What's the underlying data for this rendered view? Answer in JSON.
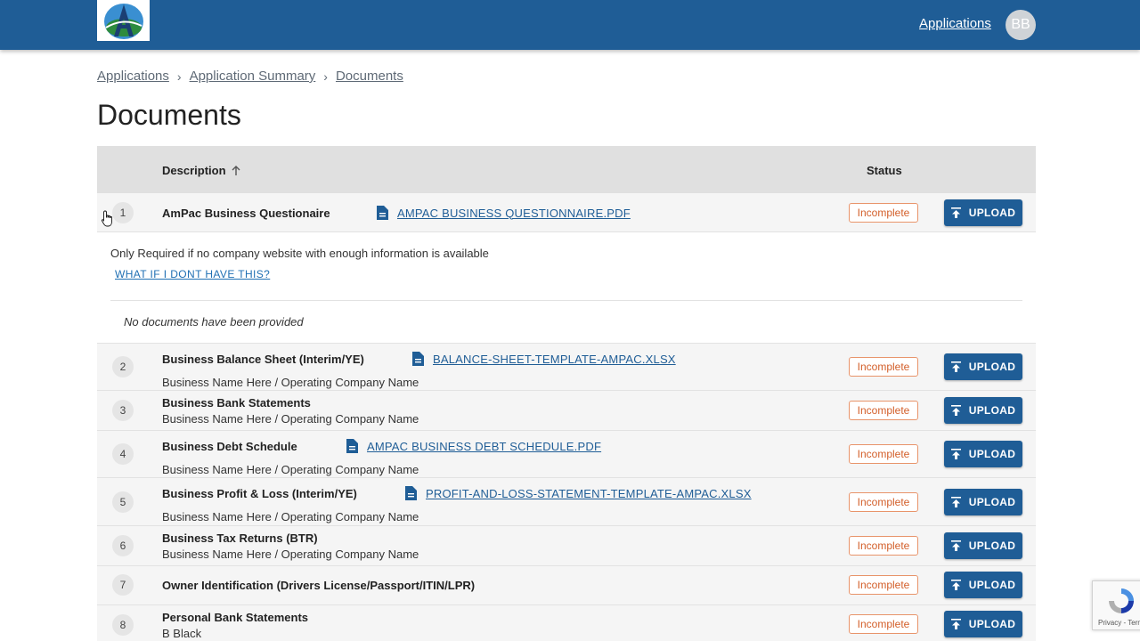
{
  "header": {
    "logo_alt": "A",
    "applications_link": "Applications",
    "avatar_initials": "BB",
    "colors": {
      "bar": "#1f5d96",
      "accent": "#1f5d96",
      "status": "#d35f2a"
    }
  },
  "breadcrumb": {
    "items": [
      "Applications",
      "Application Summary",
      "Documents"
    ],
    "separator": "›"
  },
  "page_title": "Documents",
  "table": {
    "headers": {
      "description": "Description",
      "status": "Status"
    },
    "sort_icon": "arrow-up-icon",
    "upload_label": "UPLOAD",
    "rows": [
      {
        "num": "1",
        "title": "AmPac Business Questionaire",
        "sub": "",
        "file": "AMPAC BUSINESS QUESTIONNAIRE.PDF",
        "status": "Incomplete"
      },
      {
        "num": "2",
        "title": "Business Balance Sheet (Interim/YE)",
        "sub": "Business Name Here / Operating Company Name",
        "file": "BALANCE-SHEET-TEMPLATE-AMPAC.XLSX",
        "status": "Incomplete"
      },
      {
        "num": "3",
        "title": "Business Bank Statements",
        "sub": "Business Name Here / Operating Company Name",
        "file": "",
        "status": "Incomplete"
      },
      {
        "num": "4",
        "title": "Business Debt Schedule",
        "sub": "Business Name Here / Operating Company Name",
        "file": "AMPAC BUSINESS DEBT SCHEDULE.PDF",
        "status": "Incomplete"
      },
      {
        "num": "5",
        "title": "Business Profit & Loss (Interim/YE)",
        "sub": "Business Name Here / Operating Company Name",
        "file": "PROFIT-AND-LOSS-STATEMENT-TEMPLATE-AMPAC.XLSX",
        "status": "Incomplete"
      },
      {
        "num": "6",
        "title": "Business Tax Returns (BTR)",
        "sub": "Business Name Here / Operating Company Name",
        "file": "",
        "status": "Incomplete"
      },
      {
        "num": "7",
        "title": "Owner Identification (Drivers License/Passport/ITIN/LPR)",
        "sub": "",
        "file": "",
        "status": "Incomplete"
      },
      {
        "num": "8",
        "title": "Personal Bank Statements",
        "sub": "B Black",
        "file": "",
        "status": "Incomplete"
      }
    ],
    "expanded": {
      "note": "Only Required if no company website with enough information is available",
      "help_link": "WHAT IF I DONT HAVE THIS?",
      "empty_text": "No documents have been provided"
    }
  },
  "recaptcha": {
    "text": "Privacy - Terms"
  }
}
